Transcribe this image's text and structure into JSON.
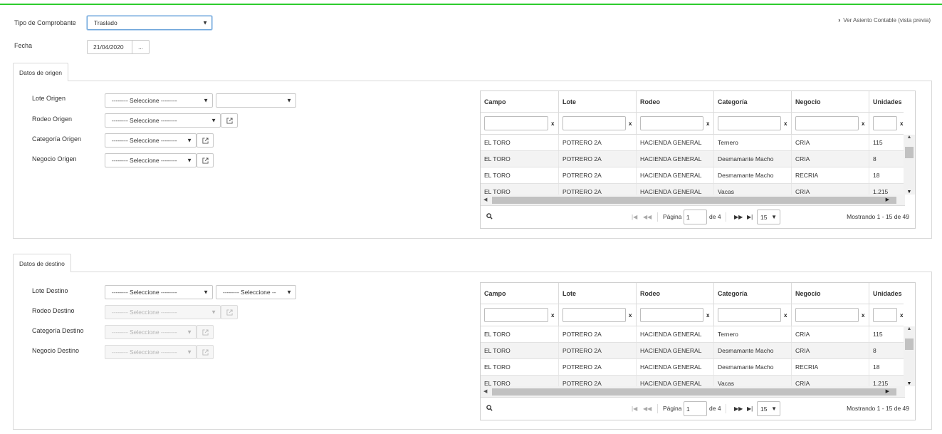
{
  "header": {
    "tipo_label": "Tipo de Comprobante",
    "tipo_value": "Traslado",
    "fecha_label": "Fecha",
    "fecha_value": "21/04/2020",
    "fecha_btn": "...",
    "asiento_link": "Ver Asiento Contable (vista previa)"
  },
  "origen": {
    "tab_label": "Datos de origen",
    "lote_label": "Lote Origen",
    "lote_value": "-------- Seleccione --------",
    "lote_value2": "",
    "rodeo_label": "Rodeo Origen",
    "rodeo_value": "-------- Seleccione --------",
    "categoria_label": "Categoría Origen",
    "categoria_value": "-------- Seleccione --------",
    "negocio_label": "Negocio Origen",
    "negocio_value": "-------- Seleccione --------"
  },
  "destino": {
    "tab_label": "Datos de destino",
    "lote_label": "Lote Destino",
    "lote_value": "-------- Seleccione --------",
    "lote_value2": "-------- Seleccione --",
    "rodeo_label": "Rodeo Destino",
    "rodeo_value": "-------- Seleccione --------",
    "categoria_label": "Categoría Destino",
    "categoria_value": "-------- Seleccione --------",
    "negocio_label": "Negocio Destino",
    "negocio_value": "-------- Seleccione --------"
  },
  "grid": {
    "columns": [
      "Campo",
      "Lote",
      "Rodeo",
      "Categoría",
      "Negocio",
      "Unidades"
    ],
    "filter_clear": "x",
    "rows": [
      [
        "EL TORO",
        "POTRERO 2A",
        "HACIENDA GENERAL",
        "Ternero",
        "CRIA",
        "115"
      ],
      [
        "EL TORO",
        "POTRERO 2A",
        "HACIENDA GENERAL",
        "Desmamante Macho",
        "CRIA",
        "8"
      ],
      [
        "EL TORO",
        "POTRERO 2A",
        "HACIENDA GENERAL",
        "Desmamante Macho",
        "RECRIA",
        "18"
      ],
      [
        "EL TORO",
        "POTRERO 2A",
        "HACIENDA GENERAL",
        "Vacas",
        "CRIA",
        "1.215"
      ]
    ],
    "pager": {
      "page_label": "Página",
      "page_value": "1",
      "of_label": "de 4",
      "page_size": "15",
      "info": "Mostrando 1 - 15 de 49"
    }
  },
  "colors": {
    "accent_bar": "#2ecc2e"
  },
  "icons": {
    "external": "external-link-icon",
    "search": "search-icon",
    "chevron": "chevron-right-icon",
    "caret": "caret-down-icon"
  }
}
